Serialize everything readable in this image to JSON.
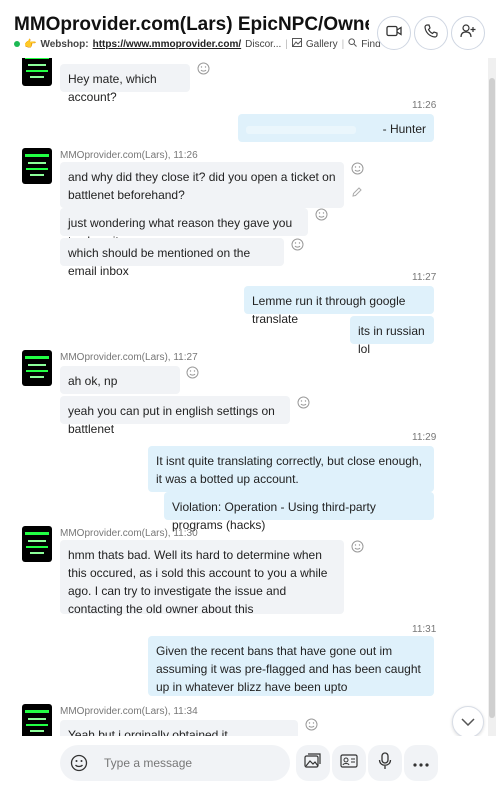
{
  "header": {
    "title": "MMOprovider.com(Lars) EpicNPC/Owne...",
    "webshop_label": "Webshop:",
    "webshop_url": "https://www.mmoprovider.com/",
    "discord_text": "Discor...",
    "gallery_label": "Gallery",
    "find_label": "Find",
    "emoji": "👉",
    "icons": [
      "video-call-icon",
      "call-icon",
      "add-person-icon"
    ]
  },
  "messages": {
    "m0": {
      "text": "Hey mate, which account?"
    },
    "t1": "11:26",
    "o1": {
      "text": "- Hunter"
    },
    "s2": "MMOprovider.com(Lars), 11:26",
    "m2a": {
      "text": "and why did they close it? did you open a ticket on battlenet beforehand?"
    },
    "m2b": {
      "text": "just wondering what reason they gave you to close it"
    },
    "m2c": {
      "text": "which should be mentioned on the email inbox"
    },
    "t2": "11:27",
    "o2a": {
      "text": "Lemme run it through google translate"
    },
    "o2b": {
      "text": "its in russian lol"
    },
    "s3": "MMOprovider.com(Lars), 11:27",
    "m3a": {
      "text": "ah ok, np"
    },
    "m3b": {
      "text": "yeah you can put in english settings on battlenet"
    },
    "t3": "11:29",
    "o3a": {
      "text": "It isnt quite translating correctly, but close enough, it was a botted up account."
    },
    "o3b": {
      "text": "Violation: Operation - Using third-party programs (hacks)"
    },
    "s4": "MMOprovider.com(Lars), 11:30",
    "m4": {
      "text": "hmm thats bad. Well its hard to determine when this occured, as i sold this account to you a while ago. I can try to investigate the issue and contacting the old owner about this"
    },
    "t4": "11:31",
    "o4": {
      "text": "Given the recent bans that have gone out im assuming it was pre-flagged and has been caught up in whatever blizz have been upto"
    },
    "s5": "MMOprovider.com(Lars), 11:34",
    "m5": {
      "text": "Yeah but i orginally obtained it somewhere in April"
    }
  },
  "composer": {
    "placeholder": "Type a message",
    "icons": [
      "emoji-icon",
      "gallery-icon",
      "contact-card-icon",
      "microphone-icon",
      "more-icon"
    ]
  },
  "colors": {
    "incoming": "#f1f3f6",
    "outgoing": "#dff1fb",
    "online": "#1db954"
  }
}
